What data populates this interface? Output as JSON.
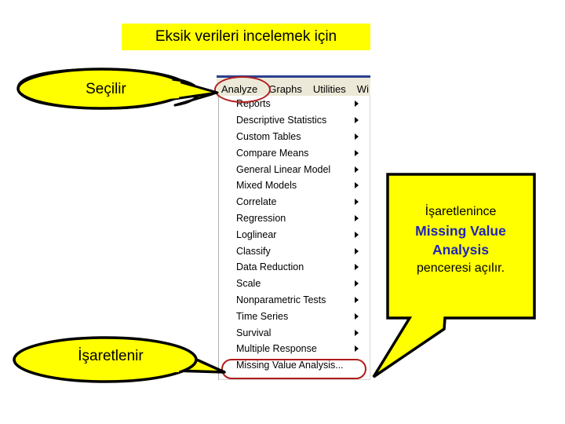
{
  "slide": {
    "title": "Eksik verileri incelemek için",
    "background_color": "#ffffff",
    "highlight_color": "#ffff00",
    "annotation_color": "#b01c1c",
    "emphasis_color": "#1f25b5"
  },
  "menu_bar": {
    "items": [
      {
        "label": "Analyze",
        "circled": true
      },
      {
        "label": "Graphs",
        "circled": false
      },
      {
        "label": "Utilities",
        "circled": false
      },
      {
        "label": "Wi",
        "circled": false
      }
    ]
  },
  "dropdown": {
    "items": [
      {
        "label": "Reports",
        "has_submenu": true
      },
      {
        "label": "Descriptive Statistics",
        "has_submenu": true
      },
      {
        "label": "Custom Tables",
        "has_submenu": true
      },
      {
        "label": "Compare Means",
        "has_submenu": true
      },
      {
        "label": "General Linear Model",
        "has_submenu": true
      },
      {
        "label": "Mixed Models",
        "has_submenu": true
      },
      {
        "label": "Correlate",
        "has_submenu": true
      },
      {
        "label": "Regression",
        "has_submenu": true
      },
      {
        "label": "Loglinear",
        "has_submenu": true
      },
      {
        "label": "Classify",
        "has_submenu": true
      },
      {
        "label": "Data Reduction",
        "has_submenu": true
      },
      {
        "label": "Scale",
        "has_submenu": true
      },
      {
        "label": "Nonparametric Tests",
        "has_submenu": true
      },
      {
        "label": "Time Series",
        "has_submenu": true
      },
      {
        "label": "Survival",
        "has_submenu": true
      },
      {
        "label": "Multiple Response",
        "has_submenu": true
      },
      {
        "label": "Missing Value Analysis...",
        "has_submenu": false
      }
    ]
  },
  "callouts": {
    "select_label": "Seçilir",
    "mark_label": "İşaretlenir",
    "right_box": {
      "line1": "İşaretlenince",
      "line2": "Missing Value",
      "line3": "Analysis",
      "line4": "penceresi açılır."
    }
  }
}
